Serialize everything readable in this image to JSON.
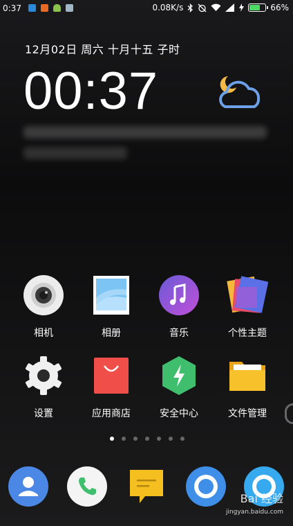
{
  "status_bar": {
    "time": "0:37",
    "network_speed": "0.08K/s",
    "battery": "66%",
    "battery_level": 0.66,
    "notification_icons": [
      "app-notification-icon-1",
      "app-notification-icon-2",
      "android-icon",
      "app-notification-icon-4"
    ],
    "status_icons": [
      "bluetooth-icon",
      "alarm-off-icon",
      "wifi-icon",
      "signal-icon",
      "charging-icon",
      "battery-icon"
    ]
  },
  "lockscreen": {
    "date": "12月02日  周六  十月十五  子时",
    "clock": "00:37",
    "weather_icon": "moon-cloud-icon"
  },
  "apps": [
    {
      "label": "相机",
      "icon": "camera-icon"
    },
    {
      "label": "相册",
      "icon": "gallery-icon"
    },
    {
      "label": "音乐",
      "icon": "music-icon"
    },
    {
      "label": "个性主题",
      "icon": "themes-icon"
    },
    {
      "label": "设置",
      "icon": "settings-icon"
    },
    {
      "label": "应用商店",
      "icon": "app-store-icon"
    },
    {
      "label": "安全中心",
      "icon": "security-icon"
    },
    {
      "label": "文件管理",
      "icon": "file-manager-icon"
    }
  ],
  "page_indicator": {
    "count": 7,
    "active": 1
  },
  "dock": [
    {
      "icon": "contacts-icon"
    },
    {
      "icon": "phone-icon"
    },
    {
      "icon": "messages-icon"
    },
    {
      "icon": "browser-icon"
    },
    {
      "icon": "search-icon"
    }
  ],
  "watermark": {
    "brand": "Bai 经验",
    "url": "jingyan.baidu.com"
  },
  "colors": {
    "battery_fill": "#4cd964",
    "weather_icon": "#6da0e6",
    "moon": "#f4b942"
  }
}
